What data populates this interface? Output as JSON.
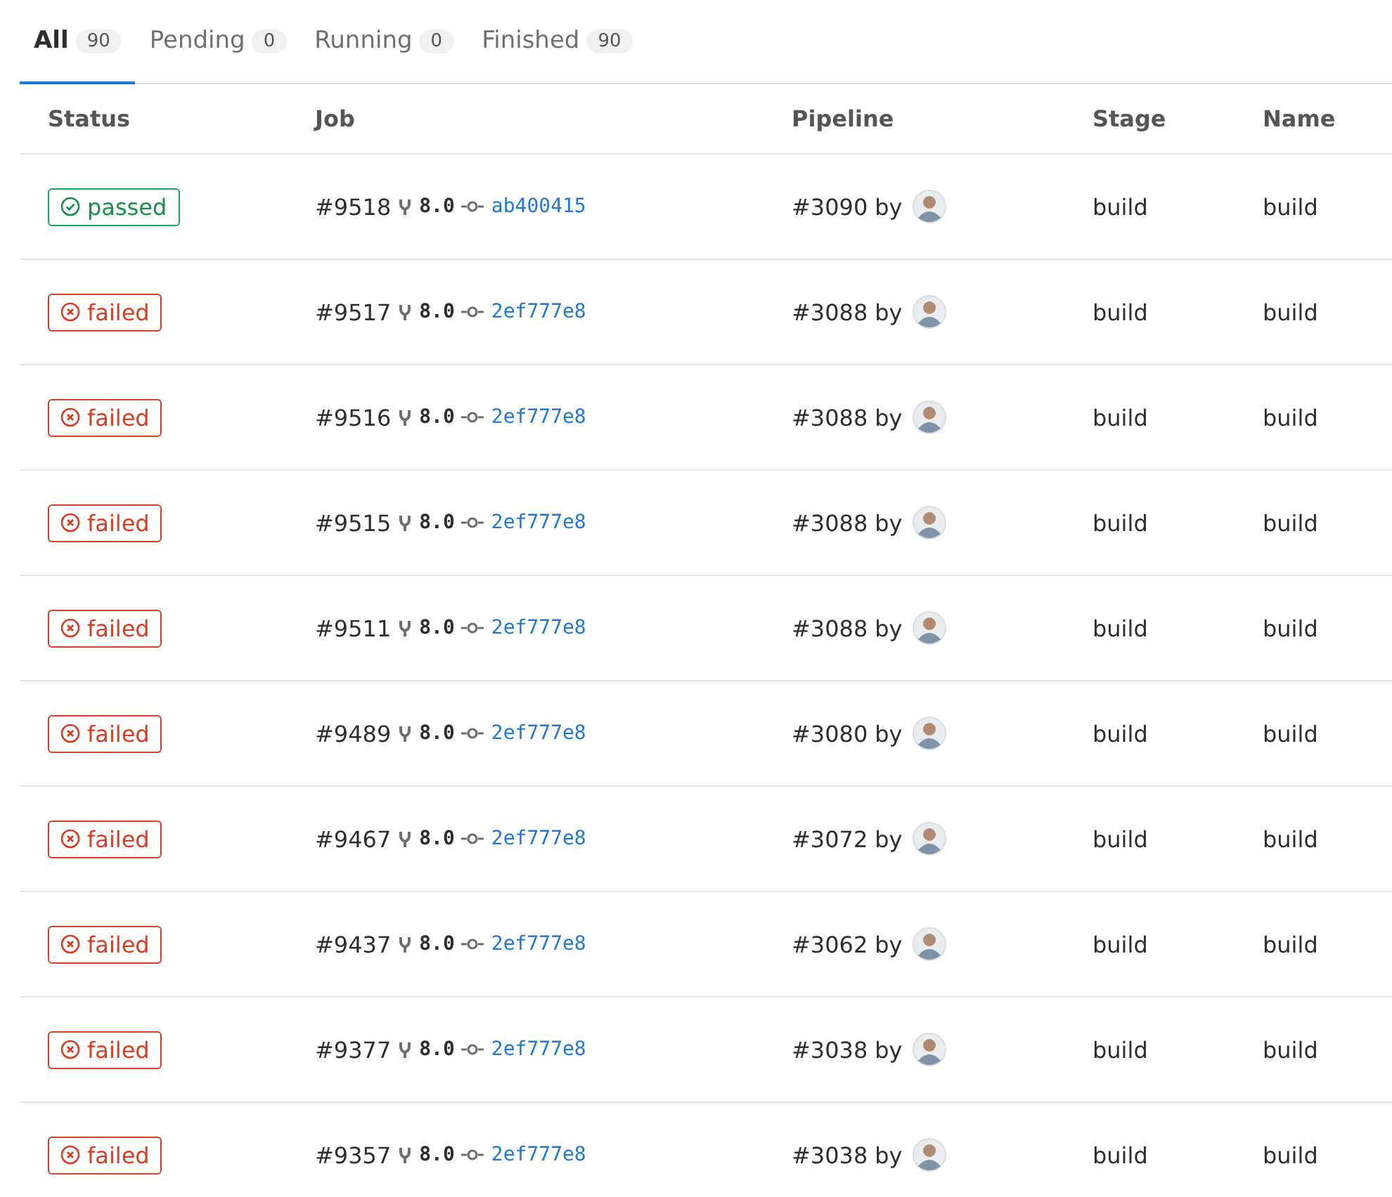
{
  "tabs": [
    {
      "label": "All",
      "count": "90",
      "selected": true
    },
    {
      "label": "Pending",
      "count": "0",
      "selected": false
    },
    {
      "label": "Running",
      "count": "0",
      "selected": false
    },
    {
      "label": "Finished",
      "count": "90",
      "selected": false
    }
  ],
  "table": {
    "columns": [
      "Status",
      "Job",
      "Pipeline",
      "Stage",
      "Name"
    ],
    "rows": [
      {
        "status": "passed",
        "job": "#9518",
        "ref": "8.0",
        "commit": "ab400415",
        "pipeline": "#3090",
        "by": "by",
        "stage": "build",
        "name": "build"
      },
      {
        "status": "failed",
        "job": "#9517",
        "ref": "8.0",
        "commit": "2ef777e8",
        "pipeline": "#3088",
        "by": "by",
        "stage": "build",
        "name": "build"
      },
      {
        "status": "failed",
        "job": "#9516",
        "ref": "8.0",
        "commit": "2ef777e8",
        "pipeline": "#3088",
        "by": "by",
        "stage": "build",
        "name": "build"
      },
      {
        "status": "failed",
        "job": "#9515",
        "ref": "8.0",
        "commit": "2ef777e8",
        "pipeline": "#3088",
        "by": "by",
        "stage": "build",
        "name": "build"
      },
      {
        "status": "failed",
        "job": "#9511",
        "ref": "8.0",
        "commit": "2ef777e8",
        "pipeline": "#3088",
        "by": "by",
        "stage": "build",
        "name": "build"
      },
      {
        "status": "failed",
        "job": "#9489",
        "ref": "8.0",
        "commit": "2ef777e8",
        "pipeline": "#3080",
        "by": "by",
        "stage": "build",
        "name": "build"
      },
      {
        "status": "failed",
        "job": "#9467",
        "ref": "8.0",
        "commit": "2ef777e8",
        "pipeline": "#3072",
        "by": "by",
        "stage": "build",
        "name": "build"
      },
      {
        "status": "failed",
        "job": "#9437",
        "ref": "8.0",
        "commit": "2ef777e8",
        "pipeline": "#3062",
        "by": "by",
        "stage": "build",
        "name": "build"
      },
      {
        "status": "failed",
        "job": "#9377",
        "ref": "8.0",
        "commit": "2ef777e8",
        "pipeline": "#3038",
        "by": "by",
        "stage": "build",
        "name": "build"
      },
      {
        "status": "failed",
        "job": "#9357",
        "ref": "8.0",
        "commit": "2ef777e8",
        "pipeline": "#3038",
        "by": "by",
        "stage": "build",
        "name": "build"
      }
    ]
  }
}
